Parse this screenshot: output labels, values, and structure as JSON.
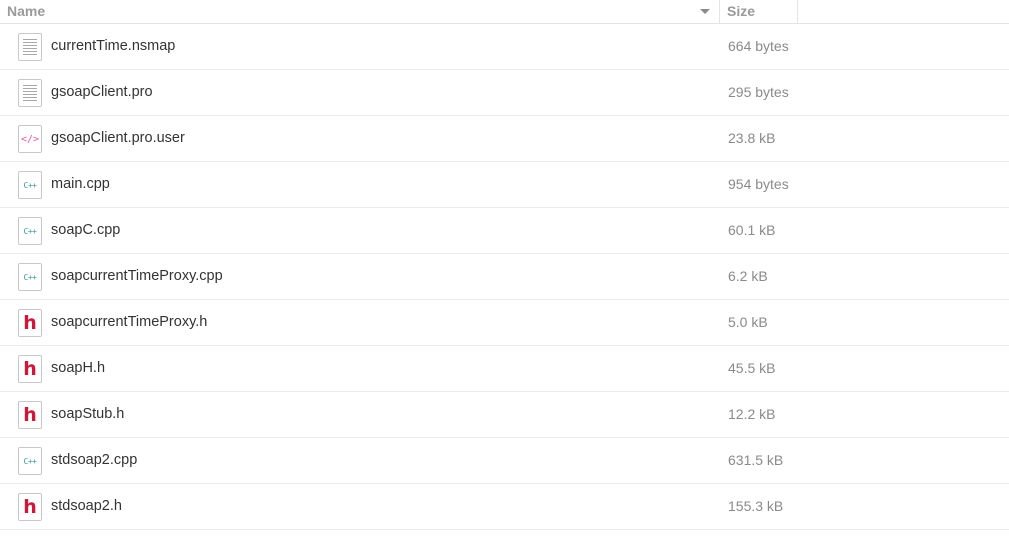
{
  "columns": {
    "name": "Name",
    "size": "Size"
  },
  "icons": {
    "text": "text-file-icon",
    "xml": "xml-file-icon",
    "cpp": "cpp-file-icon",
    "header": "header-file-icon"
  },
  "icon_glyphs": {
    "xml": "</>",
    "cpp": "C++",
    "header": "h"
  },
  "files": [
    {
      "name": "currentTime.nsmap",
      "size": "664 bytes",
      "type": "text"
    },
    {
      "name": "gsoapClient.pro",
      "size": "295 bytes",
      "type": "text"
    },
    {
      "name": "gsoapClient.pro.user",
      "size": "23.8 kB",
      "type": "xml"
    },
    {
      "name": "main.cpp",
      "size": "954 bytes",
      "type": "cpp"
    },
    {
      "name": "soapC.cpp",
      "size": "60.1 kB",
      "type": "cpp"
    },
    {
      "name": "soapcurrentTimeProxy.cpp",
      "size": "6.2 kB",
      "type": "cpp"
    },
    {
      "name": "soapcurrentTimeProxy.h",
      "size": "5.0 kB",
      "type": "header"
    },
    {
      "name": "soapH.h",
      "size": "45.5 kB",
      "type": "header"
    },
    {
      "name": "soapStub.h",
      "size": "12.2 kB",
      "type": "header"
    },
    {
      "name": "stdsoap2.cpp",
      "size": "631.5 kB",
      "type": "cpp"
    },
    {
      "name": "stdsoap2.h",
      "size": "155.3 kB",
      "type": "header"
    }
  ]
}
